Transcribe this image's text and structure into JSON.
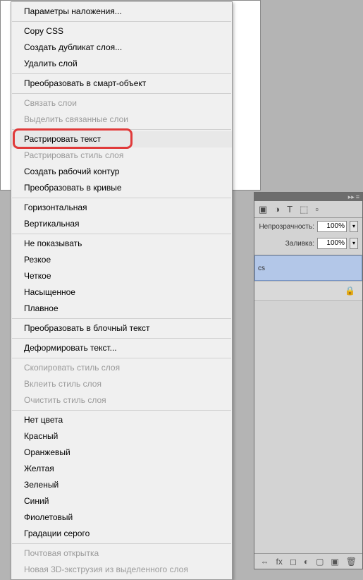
{
  "menu": {
    "groups": [
      [
        {
          "label": "Параметры наложения...",
          "disabled": false
        }
      ],
      [
        {
          "label": "Copy CSS",
          "disabled": false
        },
        {
          "label": "Создать дубликат слоя...",
          "disabled": false
        },
        {
          "label": "Удалить слой",
          "disabled": false
        }
      ],
      [
        {
          "label": "Преобразовать в смарт-объект",
          "disabled": false
        }
      ],
      [
        {
          "label": "Связать слои",
          "disabled": true
        },
        {
          "label": "Выделить связанные слои",
          "disabled": true
        }
      ],
      [
        {
          "label": "Растрировать текст",
          "disabled": false,
          "hover": true,
          "highlight": true
        },
        {
          "label": "Растрировать стиль слоя",
          "disabled": true
        },
        {
          "label": "Создать рабочий контур",
          "disabled": false
        },
        {
          "label": "Преобразовать в кривые",
          "disabled": false
        }
      ],
      [
        {
          "label": "Горизонтальная",
          "disabled": false
        },
        {
          "label": "Вертикальная",
          "disabled": false
        }
      ],
      [
        {
          "label": "Не показывать",
          "disabled": false
        },
        {
          "label": "Резкое",
          "disabled": false
        },
        {
          "label": "Четкое",
          "disabled": false
        },
        {
          "label": "Насыщенное",
          "disabled": false
        },
        {
          "label": "Плавное",
          "disabled": false
        }
      ],
      [
        {
          "label": "Преобразовать в блочный текст",
          "disabled": false
        }
      ],
      [
        {
          "label": "Деформировать текст...",
          "disabled": false
        }
      ],
      [
        {
          "label": "Скопировать стиль слоя",
          "disabled": true
        },
        {
          "label": "Вклеить стиль слоя",
          "disabled": true
        },
        {
          "label": "Очистить стиль слоя",
          "disabled": true
        }
      ],
      [
        {
          "label": "Нет цвета",
          "disabled": false
        },
        {
          "label": "Красный",
          "disabled": false
        },
        {
          "label": "Оранжевый",
          "disabled": false
        },
        {
          "label": "Желтая",
          "disabled": false
        },
        {
          "label": "Зеленый",
          "disabled": false
        },
        {
          "label": "Синий",
          "disabled": false
        },
        {
          "label": "Фиолетовый",
          "disabled": false
        },
        {
          "label": "Градации серого",
          "disabled": false
        }
      ],
      [
        {
          "label": "Почтовая открытка",
          "disabled": true
        },
        {
          "label": "Новая 3D-экструзия из выделенного слоя",
          "disabled": true
        }
      ]
    ]
  },
  "panel": {
    "opacity_label": "Непрозрачность:",
    "opacity_value": "100%",
    "fill_label": "Заливка:",
    "fill_value": "100%",
    "layer_name": "cs",
    "footer_icons": [
      "fx",
      "mask",
      "adjust",
      "group",
      "new",
      "delete"
    ]
  }
}
